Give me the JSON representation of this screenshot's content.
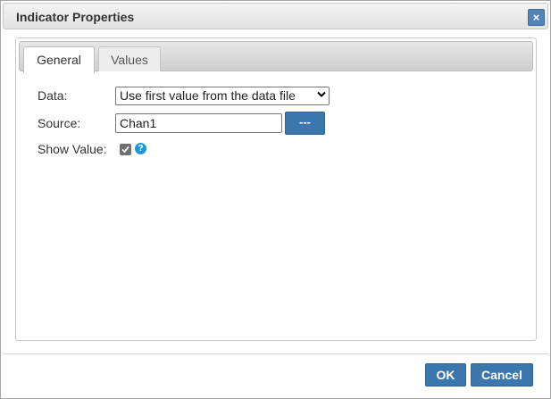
{
  "dialog": {
    "title": "Indicator Properties",
    "close_glyph": "×"
  },
  "tabs": [
    {
      "label": "General",
      "active": true
    },
    {
      "label": "Values",
      "active": false
    }
  ],
  "form": {
    "data_label": "Data:",
    "data_value": "Use first value from the data file",
    "source_label": "Source:",
    "source_value": "Chan1",
    "browse_label": "---",
    "show_value_label": "Show Value:",
    "show_value_checked": true,
    "help_glyph": "?"
  },
  "footer": {
    "ok_label": "OK",
    "cancel_label": "Cancel"
  },
  "colors": {
    "accent": "#3b76ad",
    "help": "#1d9ad6"
  },
  "icons": [
    "close-icon",
    "chevron-down-icon",
    "checkmark-icon",
    "help-icon"
  ]
}
